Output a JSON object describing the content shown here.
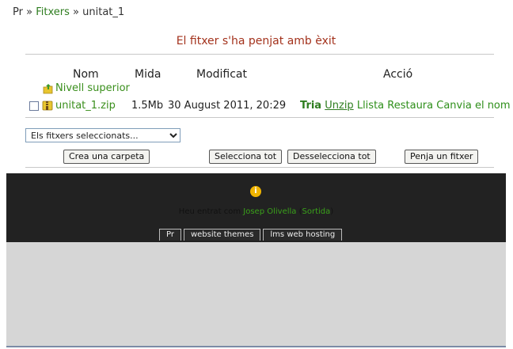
{
  "breadcrumb": {
    "root": "Pr",
    "sep1": "»",
    "files": "Fitxers",
    "sep2": "»",
    "current": "unitat_1"
  },
  "notice": "El fitxer s'ha penjat amb èxit",
  "table": {
    "headers": {
      "name": "Nom",
      "size": "Mida",
      "modified": "Modificat",
      "action": "Acció"
    },
    "parent_link": "Nivell superior",
    "rows": [
      {
        "name": "unitat_1.zip",
        "size": "1.5Mb",
        "modified": "30 August 2011, 20:29",
        "actions": {
          "tria": "Tria",
          "unzip": "Unzip",
          "list": "Llista",
          "restore": "Restaura",
          "rename": "Canvia el nom"
        }
      }
    ]
  },
  "select": {
    "value": "Els fitxers seleccionats..."
  },
  "buttons": {
    "create_folder": "Crea una carpeta",
    "select_all": "Selecciona tot",
    "deselect_all": "Desselecciona tot",
    "upload": "Penja un fitxer"
  },
  "footer": {
    "logged_prefix": "Heu entrat com",
    "user": "Josep Olivella",
    "logout_open": "(",
    "logout": "Sortida",
    "logout_close": ")",
    "tabs": [
      "Pr",
      "website themes",
      "lms web hosting"
    ]
  },
  "colors": {
    "notice": "#a3321c",
    "link": "#2e7d1f",
    "footer_bg": "#222222",
    "grey_area": "#d6d6d6"
  },
  "icons": {
    "parent": "folder-up-icon",
    "zip": "zip-file-icon",
    "info": "info-icon"
  }
}
